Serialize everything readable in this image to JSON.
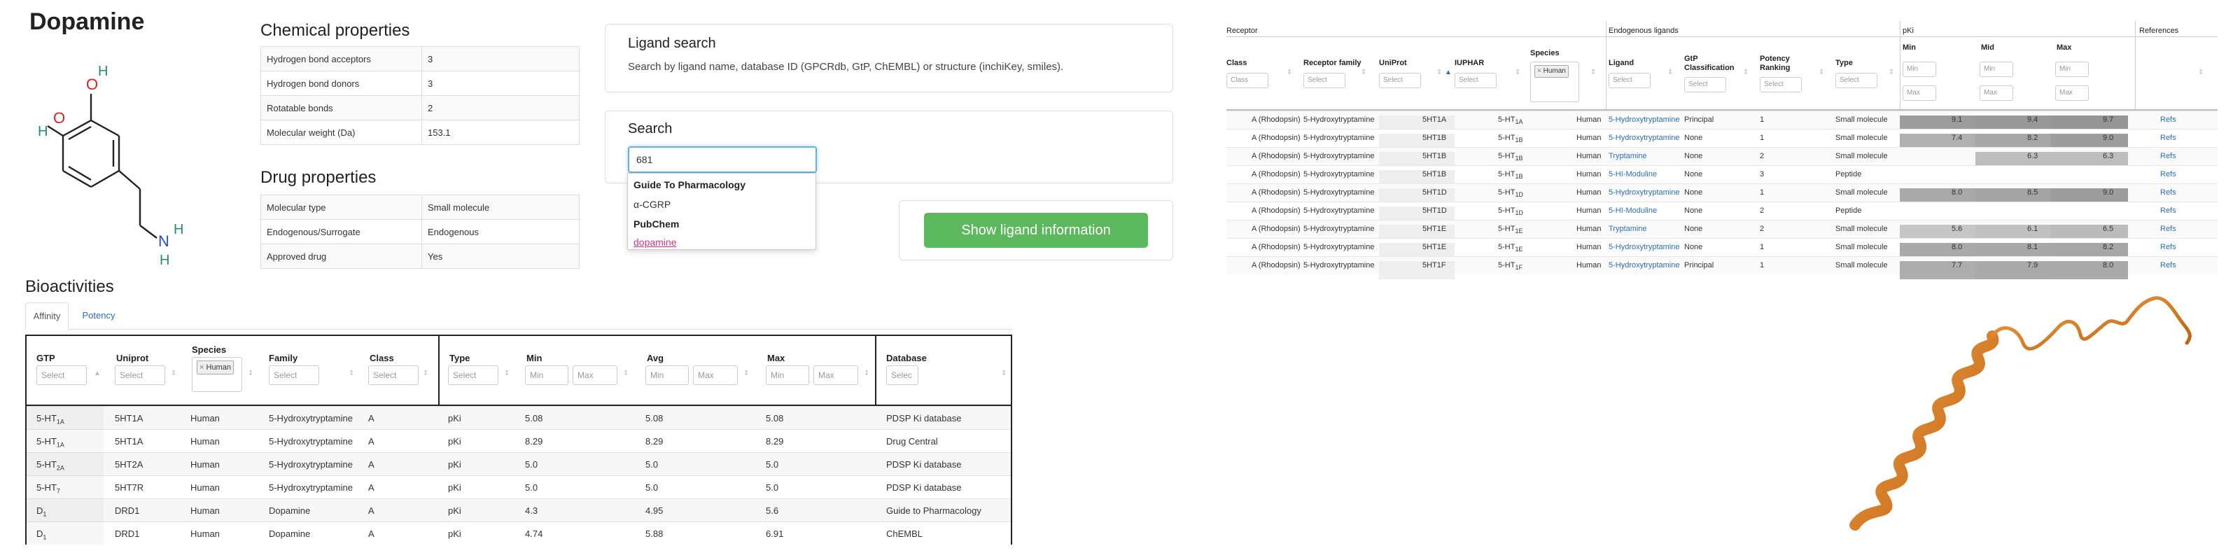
{
  "ligand_name": "Dopamine",
  "molecule": {
    "atoms": [
      "O",
      "H",
      "O",
      "H",
      "N",
      "H",
      "H"
    ]
  },
  "chemical_properties": {
    "title": "Chemical properties",
    "rows": [
      {
        "label": "Hydrogen bond acceptors",
        "value": "3"
      },
      {
        "label": "Hydrogen bond donors",
        "value": "3"
      },
      {
        "label": "Rotatable bonds",
        "value": "2"
      },
      {
        "label": "Molecular weight (Da)",
        "value": "153.1"
      }
    ]
  },
  "drug_properties": {
    "title": "Drug properties",
    "rows": [
      {
        "label": "Molecular type",
        "value": "Small molecule"
      },
      {
        "label": "Endogenous/Surrogate",
        "value": "Endogenous"
      },
      {
        "label": "Approved drug",
        "value": "Yes"
      }
    ]
  },
  "ligand_search": {
    "title": "Ligand search",
    "description": "Search by ligand name, database ID (GPCRdb, GtP, ChEMBL) or structure (inchiKey, smiles)."
  },
  "search": {
    "title": "Search",
    "input_value": "681",
    "dropdown": {
      "group1": "Guide To Pharmacology",
      "item1": "α-CGRP",
      "group2": "PubChem",
      "item2": "dopamine"
    },
    "button_label": "Show ligand information"
  },
  "bioactivities": {
    "title": "Bioactivities",
    "tabs": [
      "Affinity",
      "Potency"
    ],
    "headers": {
      "gtp": "GTP",
      "uniprot": "Uniprot",
      "species": "Species",
      "family": "Family",
      "class": "Class",
      "type": "Type",
      "min": "Min",
      "avg": "Avg",
      "max": "Max",
      "database": "Database"
    },
    "filters": {
      "select": "Select",
      "min": "Min",
      "max": "Max",
      "species_tag": "Human",
      "database_select": "Selec"
    },
    "rows": [
      {
        "gtp": "5-HT",
        "gtp_sub": "1A",
        "uniprot": "5HT1A",
        "species": "Human",
        "family": "5-Hydroxytryptamine",
        "class": "A",
        "type": "pKi",
        "min": "5.08",
        "avg": "5.08",
        "max": "5.08",
        "database": "PDSP Ki database"
      },
      {
        "gtp": "5-HT",
        "gtp_sub": "1A",
        "uniprot": "5HT1A",
        "species": "Human",
        "family": "5-Hydroxytryptamine",
        "class": "A",
        "type": "pKi",
        "min": "8.29",
        "avg": "8.29",
        "max": "8.29",
        "database": "Drug Central"
      },
      {
        "gtp": "5-HT",
        "gtp_sub": "2A",
        "uniprot": "5HT2A",
        "species": "Human",
        "family": "5-Hydroxytryptamine",
        "class": "A",
        "type": "pKi",
        "min": "5.0",
        "avg": "5.0",
        "max": "5.0",
        "database": "PDSP Ki database"
      },
      {
        "gtp": "5-HT",
        "gtp_sub": "7",
        "uniprot": "5HT7R",
        "species": "Human",
        "family": "5-Hydroxytryptamine",
        "class": "A",
        "type": "pKi",
        "min": "5.0",
        "avg": "5.0",
        "max": "5.0",
        "database": "PDSP Ki database"
      },
      {
        "gtp": "D",
        "gtp_sub": "1",
        "uniprot": "DRD1",
        "species": "Human",
        "family": "Dopamine",
        "class": "A",
        "type": "pKi",
        "min": "4.3",
        "avg": "4.95",
        "max": "5.6",
        "database": "Guide to Pharmacology"
      },
      {
        "gtp": "D",
        "gtp_sub": "1",
        "uniprot": "DRD1",
        "species": "Human",
        "family": "Dopamine",
        "class": "A",
        "type": "pKi",
        "min": "4.74",
        "avg": "5.88",
        "max": "6.91",
        "database": "ChEMBL"
      }
    ]
  },
  "receptor_table": {
    "groups": {
      "receptor": "Receptor",
      "endogenous": "Endogenous ligands",
      "pki": "pKi",
      "references": "References"
    },
    "headers": {
      "class": "Class",
      "receptor_family": "Receptor family",
      "uniprot": "UniProt",
      "iuphar": "IUPHAR",
      "species": "Species",
      "ligand": "Ligand",
      "gtp_class": "GtP Classification",
      "potency": "Potency Ranking",
      "type": "Type",
      "min": "Min",
      "mid": "Mid",
      "max": "Max"
    },
    "filters": {
      "class": "Class",
      "select": "Select",
      "min": "Min",
      "max": "Max",
      "species_tag": "Human"
    },
    "rows": [
      {
        "class": "A (Rhodopsin)",
        "family": "5-Hydroxytryptamine",
        "uniprot": "5HT1A",
        "iuphar": "5-HT",
        "iuphar_sub": "1A",
        "species": "Human",
        "ligand": "5-Hydroxytryptamine",
        "gtp": "Principal",
        "potency": "1",
        "type": "Small molecule",
        "min": "9.1",
        "mid": "9.4",
        "max": "9.7",
        "ref": "Refs"
      },
      {
        "class": "A (Rhodopsin)",
        "family": "5-Hydroxytryptamine",
        "uniprot": "5HT1B",
        "iuphar": "5-HT",
        "iuphar_sub": "1B",
        "species": "Human",
        "ligand": "5-Hydroxytryptamine",
        "gtp": "None",
        "potency": "1",
        "type": "Small molecule",
        "min": "7.4",
        "mid": "8.2",
        "max": "9.0",
        "ref": "Refs"
      },
      {
        "class": "A (Rhodopsin)",
        "family": "5-Hydroxytryptamine",
        "uniprot": "5HT1B",
        "iuphar": "5-HT",
        "iuphar_sub": "1B",
        "species": "Human",
        "ligand": "Tryptamine",
        "gtp": "None",
        "potency": "2",
        "type": "Small molecule",
        "min": "",
        "mid": "6.3",
        "max": "6.3",
        "ref": "Refs"
      },
      {
        "class": "A (Rhodopsin)",
        "family": "5-Hydroxytryptamine",
        "uniprot": "5HT1B",
        "iuphar": "5-HT",
        "iuphar_sub": "1B",
        "species": "Human",
        "ligand": "5-HI-Moduline",
        "gtp": "None",
        "potency": "3",
        "type": "Peptide",
        "min": "",
        "mid": "",
        "max": "",
        "ref": "Refs"
      },
      {
        "class": "A (Rhodopsin)",
        "family": "5-Hydroxytryptamine",
        "uniprot": "5HT1D",
        "iuphar": "5-HT",
        "iuphar_sub": "1D",
        "species": "Human",
        "ligand": "5-Hydroxytryptamine",
        "gtp": "None",
        "potency": "1",
        "type": "Small molecule",
        "min": "8.0",
        "mid": "8.5",
        "max": "9.0",
        "ref": "Refs"
      },
      {
        "class": "A (Rhodopsin)",
        "family": "5-Hydroxytryptamine",
        "uniprot": "5HT1D",
        "iuphar": "5-HT",
        "iuphar_sub": "1D",
        "species": "Human",
        "ligand": "5-HI-Moduline",
        "gtp": "None",
        "potency": "2",
        "type": "Peptide",
        "min": "",
        "mid": "",
        "max": "",
        "ref": "Refs"
      },
      {
        "class": "A (Rhodopsin)",
        "family": "5-Hydroxytryptamine",
        "uniprot": "5HT1E",
        "iuphar": "5-HT",
        "iuphar_sub": "1E",
        "species": "Human",
        "ligand": "Tryptamine",
        "gtp": "None",
        "potency": "2",
        "type": "Small molecule",
        "min": "5.6",
        "mid": "6.1",
        "max": "6.5",
        "ref": "Refs"
      },
      {
        "class": "A (Rhodopsin)",
        "family": "5-Hydroxytryptamine",
        "uniprot": "5HT1E",
        "iuphar": "5-HT",
        "iuphar_sub": "1E",
        "species": "Human",
        "ligand": "5-Hydroxytryptamine",
        "gtp": "None",
        "potency": "1",
        "type": "Small molecule",
        "min": "8.0",
        "mid": "8.1",
        "max": "8.2",
        "ref": "Refs"
      },
      {
        "class": "A (Rhodopsin)",
        "family": "5-Hydroxytryptamine",
        "uniprot": "5HT1F",
        "iuphar": "5-HT",
        "iuphar_sub": "1F",
        "species": "Human",
        "ligand": "5-Hydroxytryptamine",
        "gtp": "Principal",
        "potency": "1",
        "type": "Small molecule",
        "min": "7.7",
        "mid": "7.9",
        "max": "8.0",
        "ref": "Refs"
      }
    ]
  },
  "colors": {
    "accent_green": "#5cb85c",
    "link_blue": "#2a6ebb",
    "structure_orange": "#e8861a",
    "highlight_pink": "#d6338a"
  }
}
